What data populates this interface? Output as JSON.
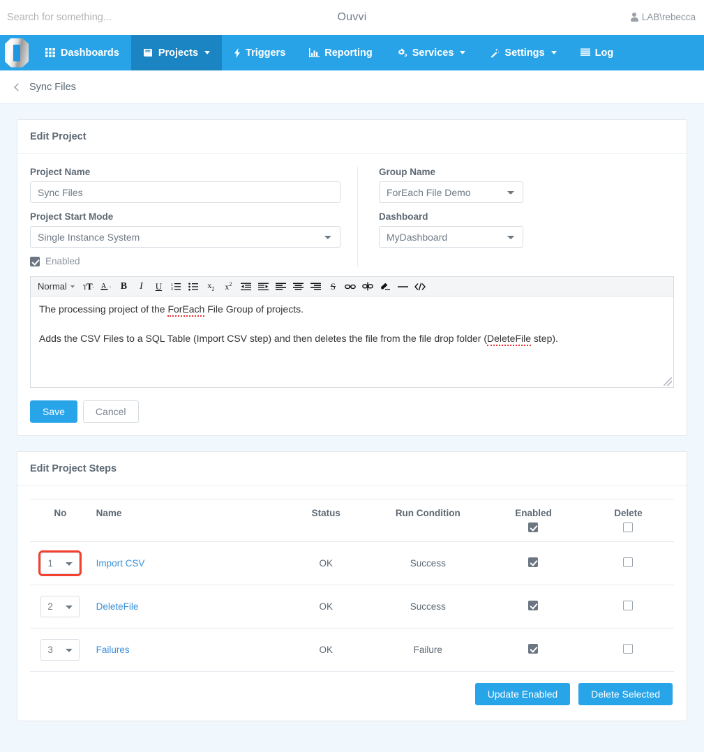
{
  "topbar": {
    "search_placeholder": "Search for something...",
    "search_value": "",
    "app_title": "Ouvvi",
    "user": "LAB\\rebecca"
  },
  "nav": {
    "items": [
      {
        "label": "Dashboards",
        "icon": "grid-icon",
        "caret": false,
        "active": false
      },
      {
        "label": "Projects",
        "icon": "book-icon",
        "caret": true,
        "active": true
      },
      {
        "label": "Triggers",
        "icon": "bolt-icon",
        "caret": false,
        "active": false
      },
      {
        "label": "Reporting",
        "icon": "bar-chart-icon",
        "caret": false,
        "active": false
      },
      {
        "label": "Services",
        "icon": "cogs-icon",
        "caret": true,
        "active": false
      },
      {
        "label": "Settings",
        "icon": "magic-wand-icon",
        "caret": true,
        "active": false
      },
      {
        "label": "Log",
        "icon": "list-icon",
        "caret": false,
        "active": false
      }
    ],
    "accent_color": "#29a3e8",
    "active_color": "#1b85c4"
  },
  "breadcrumb": {
    "back_icon": "chevron-left-icon",
    "label": "Sync Files"
  },
  "edit_project": {
    "panel_title": "Edit Project",
    "project_name": {
      "label": "Project Name",
      "value": "Sync Files"
    },
    "project_start_mode": {
      "label": "Project Start Mode",
      "value": "Single Instance System"
    },
    "group_name": {
      "label": "Group Name",
      "value": "ForEach File Demo"
    },
    "dashboard": {
      "label": "Dashboard",
      "value": "MyDashboard"
    },
    "enabled": {
      "label": "Enabled",
      "checked": true
    },
    "editor": {
      "format_label": "Normal",
      "toolbar_icons": [
        "font-size-icon",
        "text-color-icon",
        "bold-icon",
        "italic-icon",
        "underline-icon",
        "ordered-list-icon",
        "bullet-list-icon",
        "subscript-icon",
        "superscript-icon",
        "outdent-icon",
        "indent-icon",
        "align-left-icon",
        "align-center-icon",
        "align-right-icon",
        "strikethrough-icon",
        "link-icon",
        "unlink-icon",
        "clear-format-icon",
        "horizontal-rule-icon",
        "code-icon"
      ],
      "paragraph_1_before": "The processing project of the ",
      "paragraph_1_spell": "ForEach",
      "paragraph_1_after": " File Group of projects.",
      "paragraph_2_before": "Adds the CSV Files to a SQL Table (Import CSV step) and then deletes the file from the file drop folder (",
      "paragraph_2_spell": "DeleteFile",
      "paragraph_2_after": " step)."
    },
    "save_label": "Save",
    "cancel_label": "Cancel"
  },
  "edit_steps": {
    "panel_title": "Edit Project Steps",
    "columns": [
      "No",
      "Name",
      "Status",
      "Run Condition",
      "Enabled",
      "Delete"
    ],
    "header_enabled_checked": true,
    "header_delete_checked": false,
    "rows": [
      {
        "no": "1",
        "name": "Import CSV",
        "status": "OK",
        "run_condition": "Success",
        "enabled": true,
        "delete": false,
        "highlighted": true
      },
      {
        "no": "2",
        "name": "DeleteFile",
        "status": "OK",
        "run_condition": "Success",
        "enabled": true,
        "delete": false,
        "highlighted": false
      },
      {
        "no": "3",
        "name": "Failures",
        "status": "OK",
        "run_condition": "Failure",
        "enabled": true,
        "delete": false,
        "highlighted": false
      }
    ],
    "update_enabled_label": "Update Enabled",
    "delete_selected_label": "Delete Selected",
    "highlight_color": "#f4402e"
  }
}
